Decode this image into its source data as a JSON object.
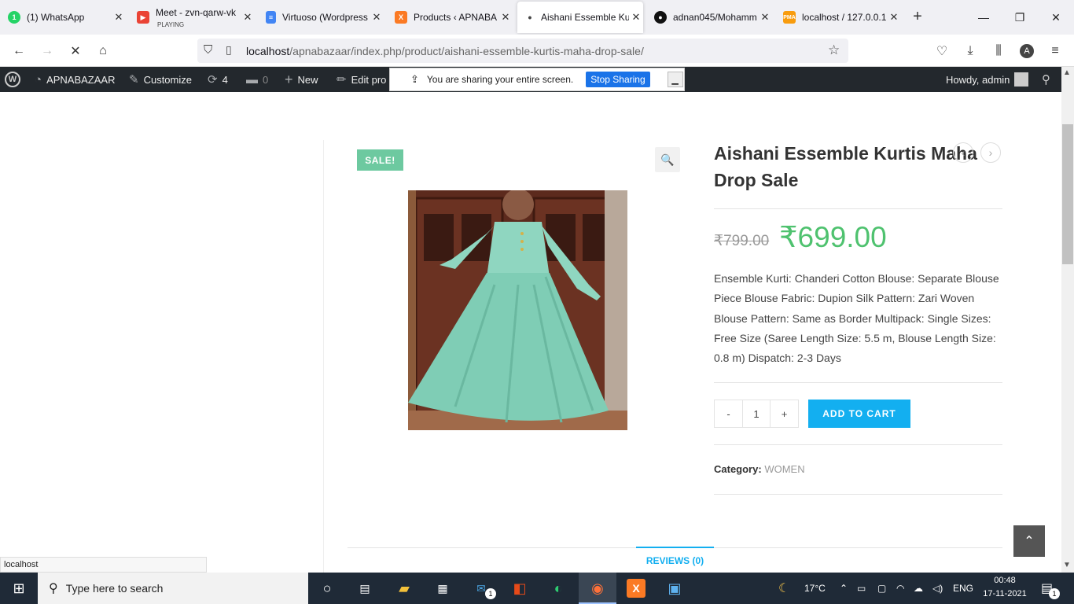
{
  "browser": {
    "tabs": [
      {
        "title": "(1) WhatsApp",
        "icon": "whatsapp-icon",
        "color": "#25d366"
      },
      {
        "title": "Meet - zvn-qarw-vk",
        "subtitle": "PLAYING",
        "icon": "meet-icon",
        "color": "#ea4335"
      },
      {
        "title": "Virtuoso (Wordpress",
        "icon": "docs-icon",
        "color": "#4285f4"
      },
      {
        "title": "Products ‹ APNABA",
        "icon": "xampp-icon",
        "color": "#fb7a24"
      },
      {
        "title": "Aishani Essemble Ku",
        "icon": "loading-dot-icon",
        "color": "#444444"
      },
      {
        "title": "adnan045/Mohamm",
        "icon": "github-icon",
        "color": "#111111"
      },
      {
        "title": "localhost / 127.0.0.1",
        "icon": "phpmyadmin-icon",
        "color": "#f89c0e"
      }
    ],
    "new_tab": "+",
    "url_host": "localhost",
    "url_path": "/apnabazaar/index.php/product/aishani-essemble-kurtis-maha-drop-sale/",
    "profile_letter": "A"
  },
  "wpbar": {
    "site": "APNABAZAAR",
    "customize": "Customize",
    "updates": "4",
    "comments": "0",
    "new": "New",
    "edit": "Edit pro",
    "howdy": "Howdy, admin"
  },
  "share": {
    "message": "You are sharing your entire screen.",
    "stop": "Stop Sharing"
  },
  "product": {
    "badge": "SALE!",
    "title": "Aishani Essemble Kurtis Maha Drop Sale",
    "old_price": "₹799.00",
    "price": "₹699.00",
    "description": "Ensemble Kurti: Chanderi Cotton Blouse: Separate Blouse Piece Blouse Fabric: Dupion Silk Pattern: Zari Woven Blouse Pattern: Same as Border Multipack: Single Sizes: Free Size (Saree Length Size: 5.5 m, Blouse Length Size: 0.8 m) Dispatch: 2-3 Days",
    "qty_minus": "-",
    "qty": "1",
    "qty_plus": "+",
    "add_to_cart": "ADD TO CART",
    "category_label": "Category:",
    "category": "WOMEN",
    "reviews_tab": "REVIEWS (0)"
  },
  "statusbar": "localhost",
  "taskbar": {
    "search_placeholder": "Type here to search",
    "temp": "17°C",
    "lang": "ENG",
    "time": "00:48",
    "date": "17-11-2021",
    "notif_count": "1",
    "mail_badge": "1"
  }
}
